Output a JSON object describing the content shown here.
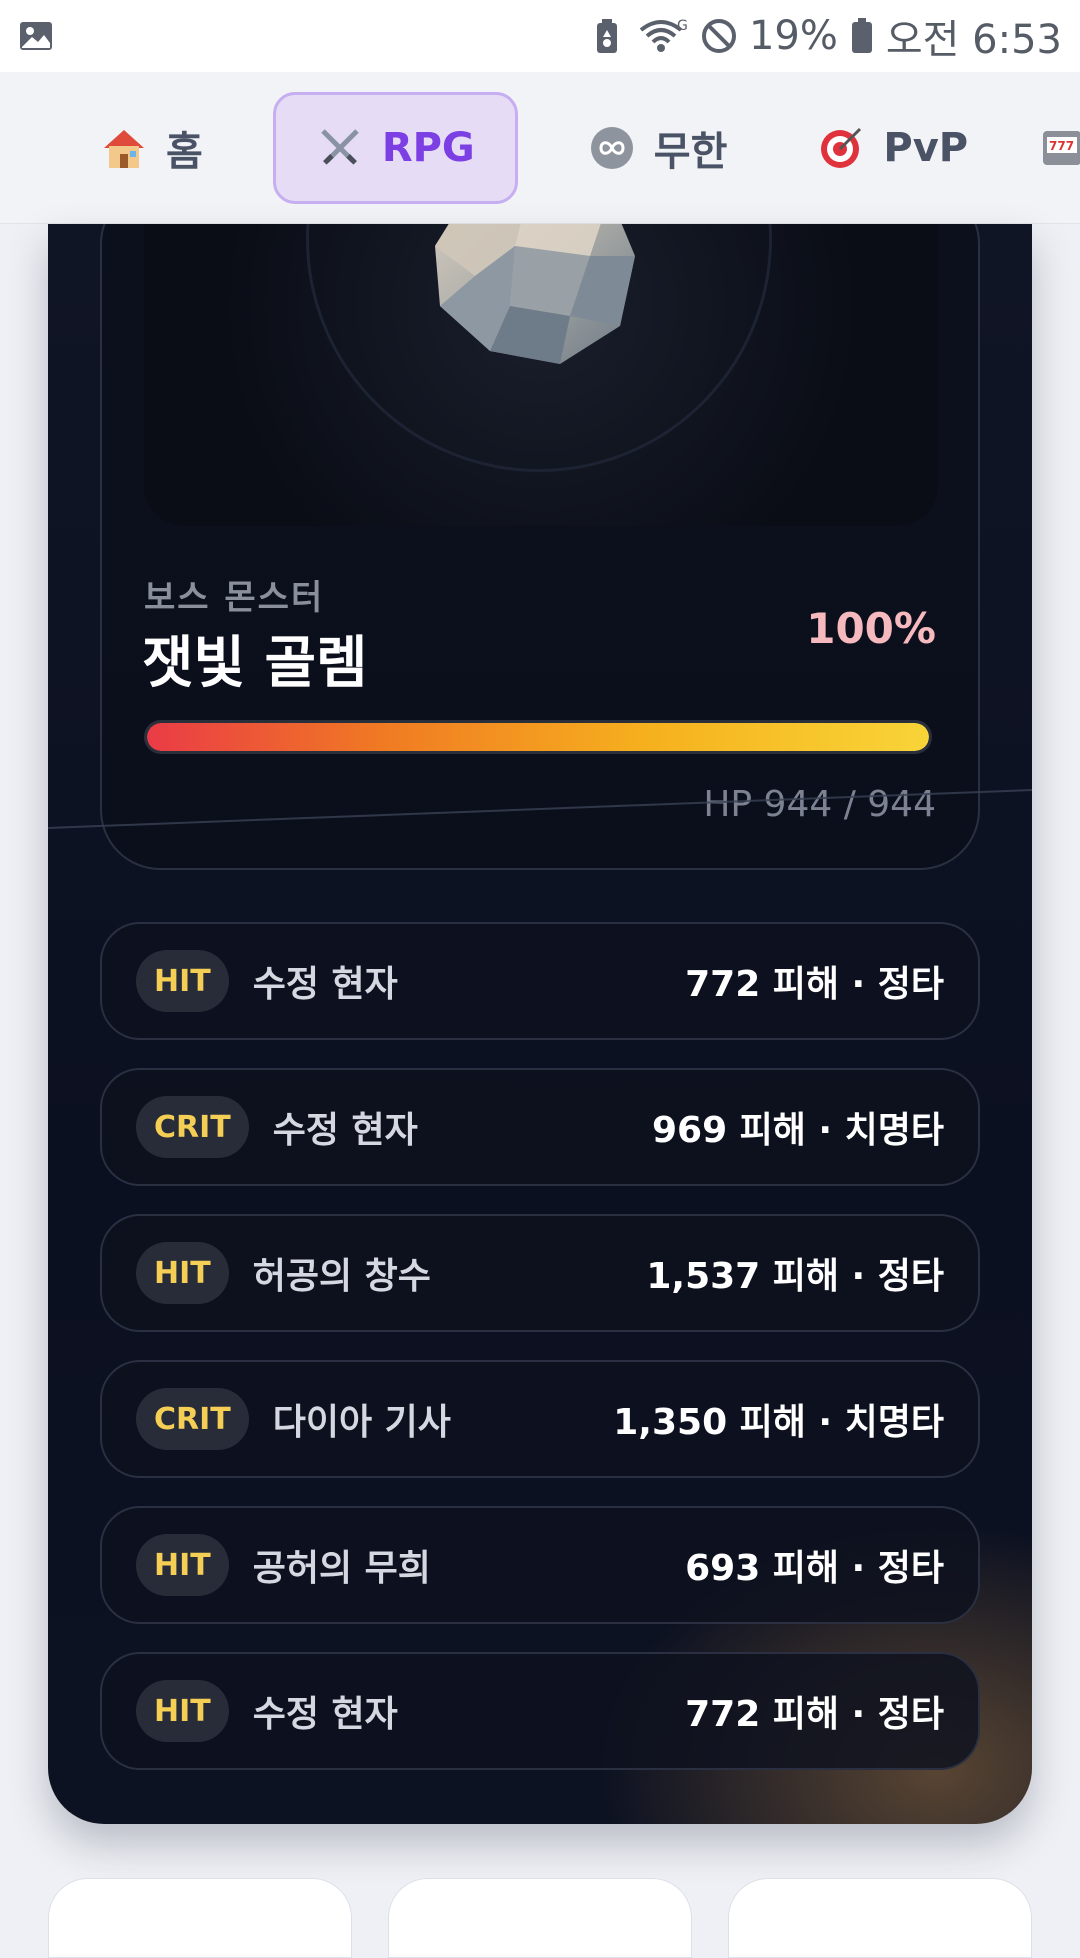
{
  "statusbar": {
    "battery_pct": "19%",
    "time": "오전 6:53",
    "icons": [
      "gallery-icon",
      "battery-saver-icon",
      "wifi-icon",
      "no-disturb-icon",
      "battery-icon"
    ]
  },
  "nav": {
    "tabs": [
      {
        "label": "홈",
        "icon": "house-icon",
        "active": false
      },
      {
        "label": "RPG",
        "icon": "crossed-swords-icon",
        "active": true
      },
      {
        "label": "무한",
        "icon": "infinity-icon",
        "active": false
      },
      {
        "label": "PvP",
        "icon": "target-icon",
        "active": false
      }
    ]
  },
  "boss": {
    "label": "보스 몬스터",
    "name": "잿빛 골렘",
    "hp_percent_text": "100%",
    "hp_fraction": 1.0,
    "hp_text": "HP 944 / 944"
  },
  "log": [
    {
      "badge": "HIT",
      "name": "수정 현자",
      "damage": "772 피해 · 정타"
    },
    {
      "badge": "CRIT",
      "name": "수정 현자",
      "damage": "969 피해 · 치명타"
    },
    {
      "badge": "HIT",
      "name": "허공의 창수",
      "damage": "1,537 피해 · 정타"
    },
    {
      "badge": "CRIT",
      "name": "다이아 기사",
      "damage": "1,350 피해 · 치명타"
    },
    {
      "badge": "HIT",
      "name": "공허의 무희",
      "damage": "693 피해 · 정타"
    },
    {
      "badge": "HIT",
      "name": "수정 현자",
      "damage": "772 피해 · 정타"
    }
  ],
  "colors": {
    "accent": "#7b3fe4",
    "badge_text": "#f5cf55",
    "card_bg": "#0b1020"
  }
}
